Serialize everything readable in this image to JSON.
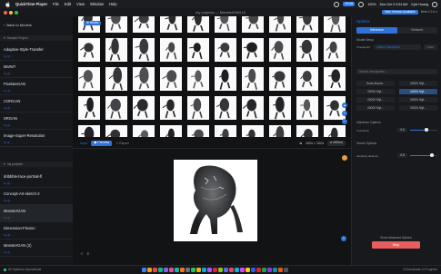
{
  "menubar": {
    "apple": "",
    "app": "QuickTime Player",
    "items": [
      "File",
      "Edit",
      "View",
      "Window",
      "Help"
    ],
    "battery": "100%",
    "clock": "Mon Oct 5 9:54 AM",
    "user": "Kyle Huang",
    "screen_badge": "00:06"
  },
  "window": {
    "title": "my projects — MonsterGAN UI",
    "update_button": "New Version Available",
    "version": "Beta 0.2.6.4"
  },
  "sidebar": {
    "back_label": "Back to Models",
    "section1": "Sample Project",
    "models": [
      {
        "title": "Adaptive-Style-Transfer",
        "sub": "by @..."
      },
      {
        "title": "MUNIT",
        "sub": "by @..."
      },
      {
        "title": "PixelateGAN",
        "sub": "by @..."
      },
      {
        "title": "CORGAN",
        "sub": "by @..."
      },
      {
        "title": "SRGAN",
        "sub": "by @..."
      },
      {
        "title": "Image-Super-Resolution",
        "sub": "by @..."
      }
    ],
    "section2": "my projects",
    "projects": [
      {
        "title": "dribbble-face-portrait-fl",
        "sub": "by @..."
      },
      {
        "title": "Concept-Art-sketch-2",
        "sub": "by @..."
      },
      {
        "title": "MonsterGAN",
        "sub": "by @..."
      },
      {
        "title": "Dimension-Flexion",
        "sub": "by @..."
      },
      {
        "title": "MonsterGAN (2)",
        "sub": "by @..."
      }
    ]
  },
  "main": {
    "new_button": "Works",
    "tabs": [
      "Input",
      "Preview",
      "Export"
    ],
    "active_tab": "Preview",
    "resolution": "1024 × 1024",
    "speed": "490ms"
  },
  "rpanel": {
    "title": "Options",
    "segments": [
      "Inference",
      "Network"
    ],
    "model_setup": "Model Setup",
    "checkpoint_label": "Checkpoint",
    "checkpoint_value": "Latest Checkpoint",
    "load_label": "Load",
    "search_placeholder": "Search checkpoints...",
    "grid": [
      [
        "Snow Mount...",
        "00000 Styl..."
      ],
      [
        "00000 Styl...",
        "00000 Styl..."
      ],
      [
        "00000 Styl...",
        "00000 Styl..."
      ],
      [
        "00000 Styl...",
        "00000 Styl..."
      ]
    ],
    "inference_options": "Inference Options",
    "truncation_label": "Truncation",
    "truncation_value": "0.6",
    "vector_options": "Vector Options",
    "sampling_label": "sampling distance",
    "sampling_value": "0.8",
    "advanced_link": "Show Advanced Options",
    "run_button": "Stop"
  },
  "status": {
    "left": "All Systems Operational",
    "right": "3 Downloads In Progress"
  }
}
